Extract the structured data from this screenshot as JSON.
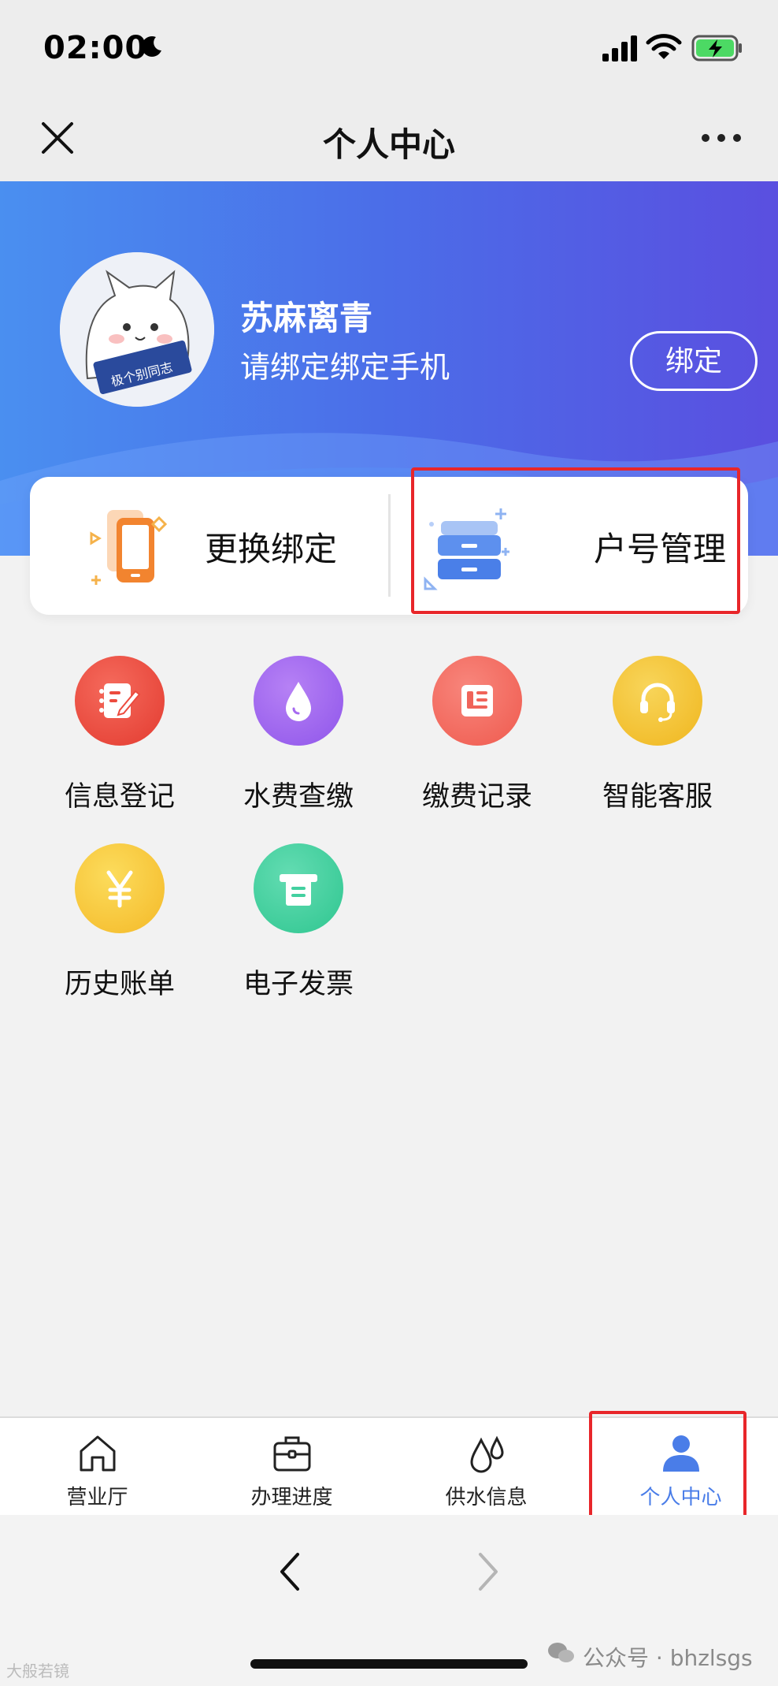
{
  "status_bar": {
    "time": "02:00"
  },
  "nav": {
    "title": "个人中心"
  },
  "profile": {
    "name": "苏麻离青",
    "subtitle": "请绑定绑定手机",
    "bind_button": "绑定",
    "avatar_badge": "极个别同志"
  },
  "actions": [
    {
      "label": "更换绑定",
      "icon": "phone-change-icon"
    },
    {
      "label": "户号管理",
      "icon": "account-drawer-icon"
    }
  ],
  "grid": [
    {
      "label": "信息登记",
      "icon": "register-icon",
      "color": "#ec4b3e"
    },
    {
      "label": "水费查缴",
      "icon": "water-drop-icon",
      "color": "#a66af0"
    },
    {
      "label": "缴费记录",
      "icon": "record-list-icon",
      "color": "#f0645a"
    },
    {
      "label": "智能客服",
      "icon": "headset-icon",
      "color": "#f2c230"
    },
    {
      "label": "历史账单",
      "icon": "yen-icon",
      "color": "#f7c93a"
    },
    {
      "label": "电子发票",
      "icon": "invoice-icon",
      "color": "#43d0a0"
    }
  ],
  "tabs": [
    {
      "label": "营业厅",
      "icon": "home-icon",
      "active": false
    },
    {
      "label": "办理进度",
      "icon": "briefcase-icon",
      "active": false
    },
    {
      "label": "供水信息",
      "icon": "drops-icon",
      "active": false
    },
    {
      "label": "个人中心",
      "icon": "user-icon",
      "active": true
    }
  ],
  "watermark": {
    "left": "大般若镜",
    "right": "公众号 · bhzlsgs"
  },
  "colors": {
    "banner_start": "#4a8ff0",
    "banner_end": "#5a4fe0",
    "active_tab": "#4a7de8",
    "highlight": "#e8262a"
  }
}
